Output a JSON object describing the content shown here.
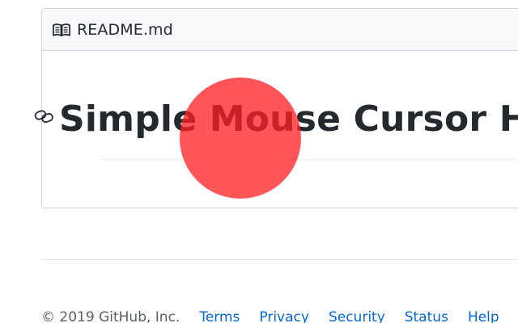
{
  "readme": {
    "filename": "README.md",
    "title": "Simple Mouse Cursor H"
  },
  "icons": {
    "book": "book-icon",
    "anchor": "link-icon"
  },
  "cursor_highlight": {
    "color": "#ff1e23"
  },
  "footer": {
    "copyright": "© 2019 GitHub, Inc.",
    "links": [
      "Terms",
      "Privacy",
      "Security",
      "Status",
      "Help"
    ]
  },
  "colors": {
    "link": "#0366d6",
    "text": "#24292e",
    "muted": "#586069",
    "border": "#d1d5da",
    "header_bg": "#f6f8fa"
  }
}
